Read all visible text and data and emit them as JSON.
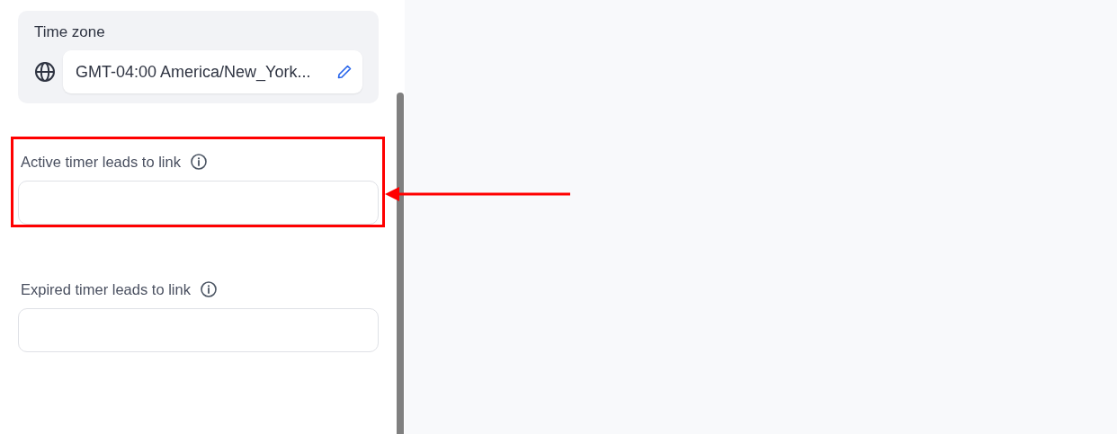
{
  "time_zone": {
    "label": "Time zone",
    "value": "GMT-04:00 America/New_York..."
  },
  "fields": [
    {
      "label": "Active timer leads to link",
      "highlighted": true
    },
    {
      "label": "Expired timer leads to link",
      "highlighted": false
    }
  ]
}
